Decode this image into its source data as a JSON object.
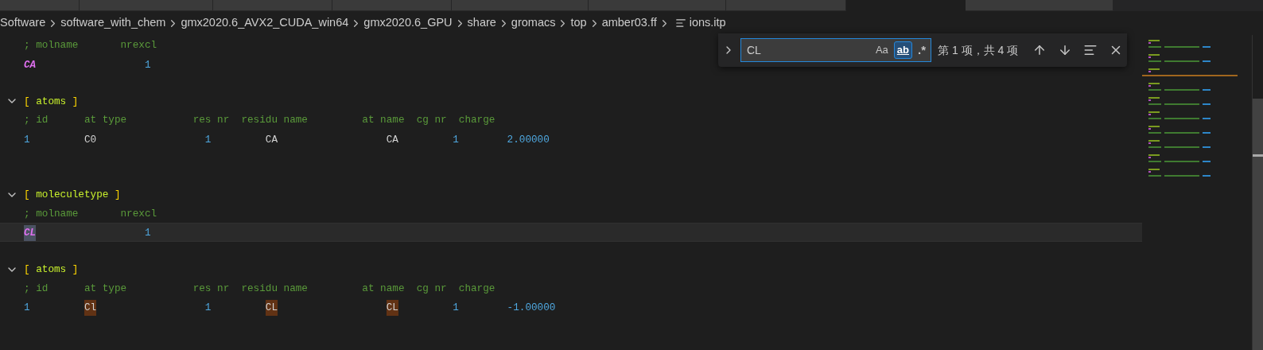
{
  "tabs": [
    {
      "selected": false
    },
    {
      "selected": false
    },
    {
      "selected": false
    },
    {
      "selected": false
    },
    {
      "selected": false
    },
    {
      "selected": false
    },
    {
      "selected": false
    },
    {
      "selected": true
    },
    {
      "selected": false
    }
  ],
  "breadcrumb": [
    "Software",
    "software_with_chem",
    "gmx2020.6_AVX2_CUDA_win64",
    "gmx2020.6_GPU",
    "share",
    "gromacs",
    "top",
    "amber03.ff",
    "ions.itp"
  ],
  "find": {
    "value": "CL",
    "match_case": {
      "label": "Aa",
      "on": false
    },
    "whole_word": {
      "label": "ab",
      "on": true
    },
    "regex": {
      "label": ".*",
      "on": false
    },
    "result": "第 1 项，共 4 项"
  },
  "lines": [
    {
      "kind": "comment",
      "text": "; molname       nrexcl",
      "current": false
    },
    {
      "kind": "mol",
      "current": false,
      "cells": [
        {
          "text": "CA",
          "kind": "name",
          "match": false,
          "selected": false
        },
        {
          "text": "1",
          "kind": "number",
          "match": false,
          "selected": false
        }
      ]
    },
    {
      "kind": "blank",
      "current": false
    },
    {
      "kind": "section",
      "open": "[",
      "name": "atoms",
      "close": "]",
      "expanded": true,
      "current": false
    },
    {
      "kind": "comment",
      "text": "; id      at type           res nr  residu name         at name  cg nr  charge",
      "current": false
    },
    {
      "kind": "atom",
      "current": false,
      "cells": [
        {
          "text": "1",
          "kind": "number",
          "match": false,
          "selected": false
        },
        {
          "text": "C0",
          "kind": "plain",
          "match": false,
          "selected": false
        },
        {
          "text": "1",
          "kind": "number",
          "match": false,
          "selected": false
        },
        {
          "text": "CA",
          "kind": "plain",
          "match": false,
          "selected": false
        },
        {
          "text": "CA",
          "kind": "plain",
          "match": false,
          "selected": false
        },
        {
          "text": "1",
          "kind": "number",
          "match": false,
          "selected": false
        },
        {
          "text": "2.00000",
          "kind": "number",
          "match": false,
          "selected": false
        }
      ]
    },
    {
      "kind": "blank",
      "current": false
    },
    {
      "kind": "blank",
      "current": false
    },
    {
      "kind": "section",
      "open": "[",
      "name": "moleculetype",
      "close": "]",
      "expanded": true,
      "current": false
    },
    {
      "kind": "comment",
      "text": "; molname       nrexcl",
      "current": false
    },
    {
      "kind": "mol",
      "current": true,
      "cells": [
        {
          "text": "CL",
          "kind": "name",
          "match": true,
          "selected": true
        },
        {
          "text": "1",
          "kind": "number",
          "match": false,
          "selected": false
        }
      ]
    },
    {
      "kind": "blank",
      "current": false
    },
    {
      "kind": "section",
      "open": "[",
      "name": "atoms",
      "close": "]",
      "expanded": true,
      "current": false
    },
    {
      "kind": "comment",
      "text": "; id      at type           res nr  residu name         at name  cg nr  charge",
      "current": false
    },
    {
      "kind": "atom",
      "current": false,
      "cells": [
        {
          "text": "1",
          "kind": "number",
          "match": false,
          "selected": false
        },
        {
          "text": "Cl",
          "kind": "plain",
          "match": true,
          "selected": false
        },
        {
          "text": "1",
          "kind": "number",
          "match": false,
          "selected": false
        },
        {
          "text": "CL",
          "kind": "plain",
          "match": true,
          "selected": false
        },
        {
          "text": "CL",
          "kind": "plain",
          "match": true,
          "selected": false
        },
        {
          "text": "1",
          "kind": "number",
          "match": false,
          "selected": false
        },
        {
          "text": "-1.00000",
          "kind": "number",
          "match": false,
          "selected": false
        }
      ]
    }
  ]
}
